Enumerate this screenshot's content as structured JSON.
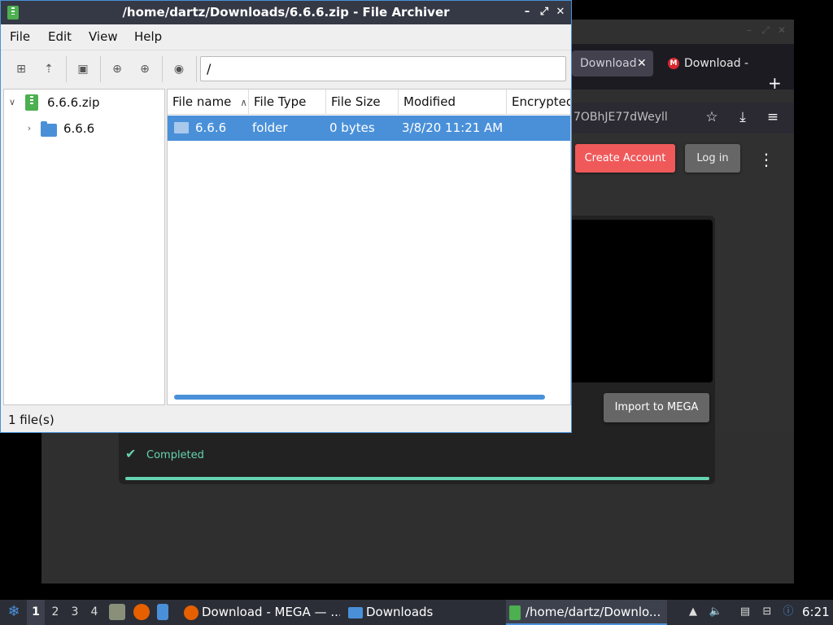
{
  "browser": {
    "tabs": [
      {
        "label": "Download",
        "active": true
      },
      {
        "label": "Download - ",
        "active": false
      }
    ],
    "url_fragment": "7OBhJE77dWeyll",
    "buttons": {
      "create_account": "Create Account",
      "login": "Log in",
      "import": "Import to MEGA"
    },
    "status_text": "Completed",
    "progress": 1.0,
    "colors": {
      "accent_green": "#65d3b0",
      "create_red": "#f0595a"
    }
  },
  "archiver": {
    "title": "/home/dartz/Downloads/6.6.6.zip - File Archiver",
    "menu": [
      "File",
      "Edit",
      "View",
      "Help"
    ],
    "path": "/",
    "tree": [
      {
        "label": "6.6.6.zip",
        "icon": "zip-icon",
        "expanded": true
      },
      {
        "label": "6.6.6",
        "icon": "folder-icon",
        "expanded": false
      }
    ],
    "columns": [
      "File name",
      "File Type",
      "File Size",
      "Modified",
      "Encrypted"
    ],
    "sort_indicator": "^",
    "rows": [
      {
        "name": "6.6.6",
        "type": "folder",
        "size": "0 bytes",
        "modified": "3/8/20 11:21 AM",
        "encrypted": ""
      }
    ],
    "status": "1 file(s)",
    "colors": {
      "selection": "#4a90d9",
      "titlebar": "#353945"
    }
  },
  "taskbar": {
    "workspaces": [
      "1",
      "2",
      "3",
      "4"
    ],
    "tasks": [
      {
        "label": "Download - MEGA — ...",
        "icon": "firefox-icon"
      },
      {
        "label": "Downloads",
        "icon": "folder-icon"
      },
      {
        "label": "/home/dartz/Downlo...",
        "icon": "archive-icon",
        "active": true
      }
    ],
    "clock": "6:21"
  }
}
